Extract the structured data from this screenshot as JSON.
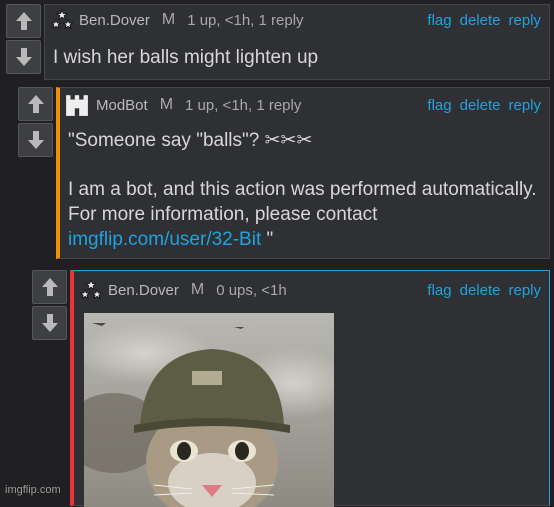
{
  "comments": [
    {
      "username": "Ben.Dover",
      "mod_letter": "M",
      "meta": "1 up, <1h, 1 reply",
      "actions": [
        "flag",
        "delete",
        "reply"
      ],
      "text": "I wish her balls might lighten up"
    },
    {
      "username": "ModBot",
      "mod_letter": "M",
      "meta": "1 up, <1h, 1 reply",
      "actions": [
        "flag",
        "delete",
        "reply"
      ],
      "line1": "\"Someone say \"balls\"? ✂✂✂",
      "line2": "I am a bot, and this action was performed automatically. For more information, please contact",
      "link": "imgflip.com/user/32-Bit",
      "tail": " \"",
      "accent": "#f0900a"
    },
    {
      "username": "Ben.Dover",
      "mod_letter": "M",
      "meta": "0 ups, <1h",
      "actions": [
        "flag",
        "delete",
        "reply"
      ],
      "accent": "#e8343a"
    }
  ],
  "watermark": "imgflip.com",
  "colors": {
    "link": "#1fa3e0",
    "background": "#202022",
    "panel": "#2f3033"
  },
  "icons": [
    "upvote-arrow-icon",
    "downvote-arrow-icon",
    "stars-avatar-icon",
    "castle-avatar-icon"
  ]
}
